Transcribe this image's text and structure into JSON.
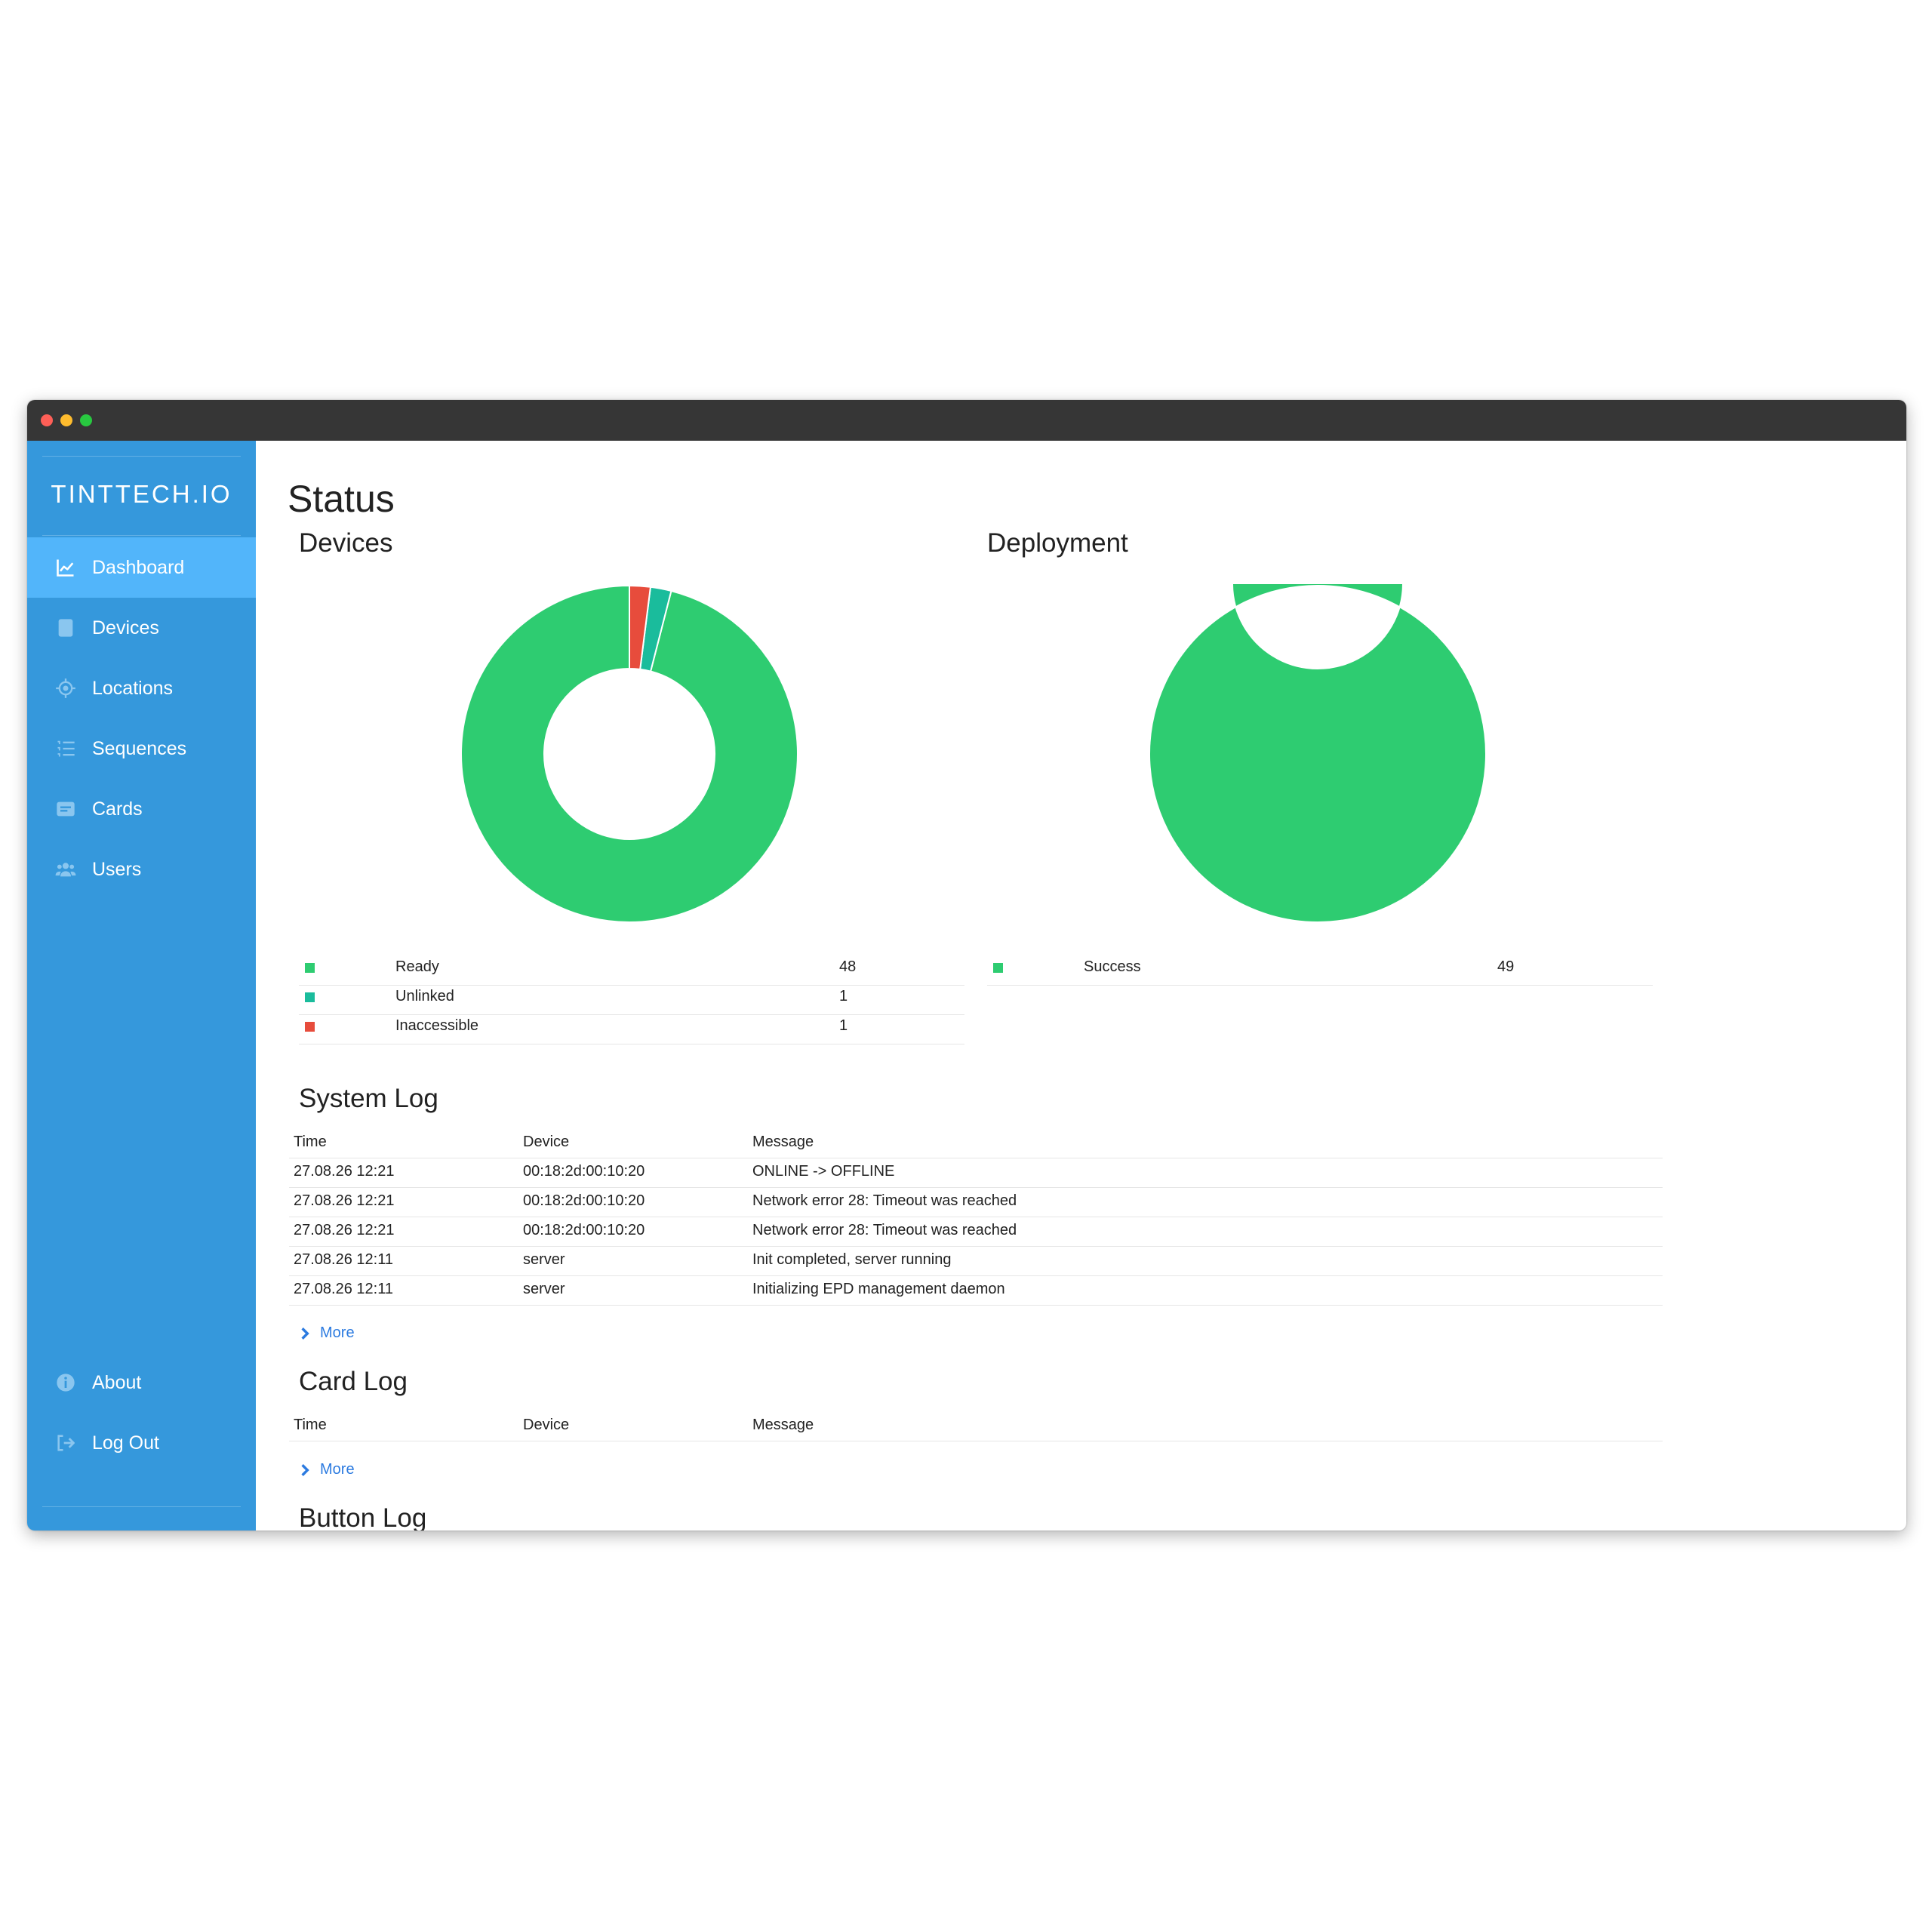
{
  "app": {
    "brand": "TINTTECH.IO",
    "accent": "#3598dc",
    "accent_active": "#52b5fa"
  },
  "sidebar": {
    "items": [
      {
        "label": "Dashboard",
        "icon": "chart-line-icon",
        "active": true
      },
      {
        "label": "Devices",
        "icon": "tablet-icon"
      },
      {
        "label": "Locations",
        "icon": "crosshair-icon"
      },
      {
        "label": "Sequences",
        "icon": "ordered-list-icon"
      },
      {
        "label": "Cards",
        "icon": "card-icon"
      },
      {
        "label": "Users",
        "icon": "users-icon"
      }
    ],
    "bottom_items": [
      {
        "label": "About",
        "icon": "info-circle-icon"
      },
      {
        "label": "Log Out",
        "icon": "logout-icon"
      }
    ]
  },
  "page": {
    "title": "Status"
  },
  "devices_chart": {
    "title": "Devices",
    "chart_data": {
      "type": "pie",
      "donut": true,
      "slices": [
        {
          "label": "Ready",
          "value": 48,
          "color": "#2ecc71"
        },
        {
          "label": "Unlinked",
          "value": 1,
          "color": "#1abc9c"
        },
        {
          "label": "Inaccessible",
          "value": 1,
          "color": "#e74c3c"
        }
      ]
    }
  },
  "deployment_chart": {
    "title": "Deployment",
    "chart_data": {
      "type": "pie",
      "donut": true,
      "slices": [
        {
          "label": "Success",
          "value": 49,
          "color": "#2ecc71"
        }
      ]
    }
  },
  "system_log": {
    "title": "System Log",
    "columns": [
      "Time",
      "Device",
      "Message"
    ],
    "rows": [
      [
        "27.08.26 12:21",
        "00:18:2d:00:10:20",
        "ONLINE -> OFFLINE"
      ],
      [
        "27.08.26 12:21",
        "00:18:2d:00:10:20",
        "Network error 28: Timeout was reached"
      ],
      [
        "27.08.26 12:21",
        "00:18:2d:00:10:20",
        "Network error 28: Timeout was reached"
      ],
      [
        "27.08.26 12:11",
        "server",
        "Init completed, server running"
      ],
      [
        "27.08.26 12:11",
        "server",
        "Initializing EPD management daemon"
      ]
    ],
    "more_label": "More"
  },
  "card_log": {
    "title": "Card Log",
    "columns": [
      "Time",
      "Device",
      "Message"
    ],
    "rows": [],
    "more_label": "More"
  },
  "button_log": {
    "title": "Button Log"
  }
}
